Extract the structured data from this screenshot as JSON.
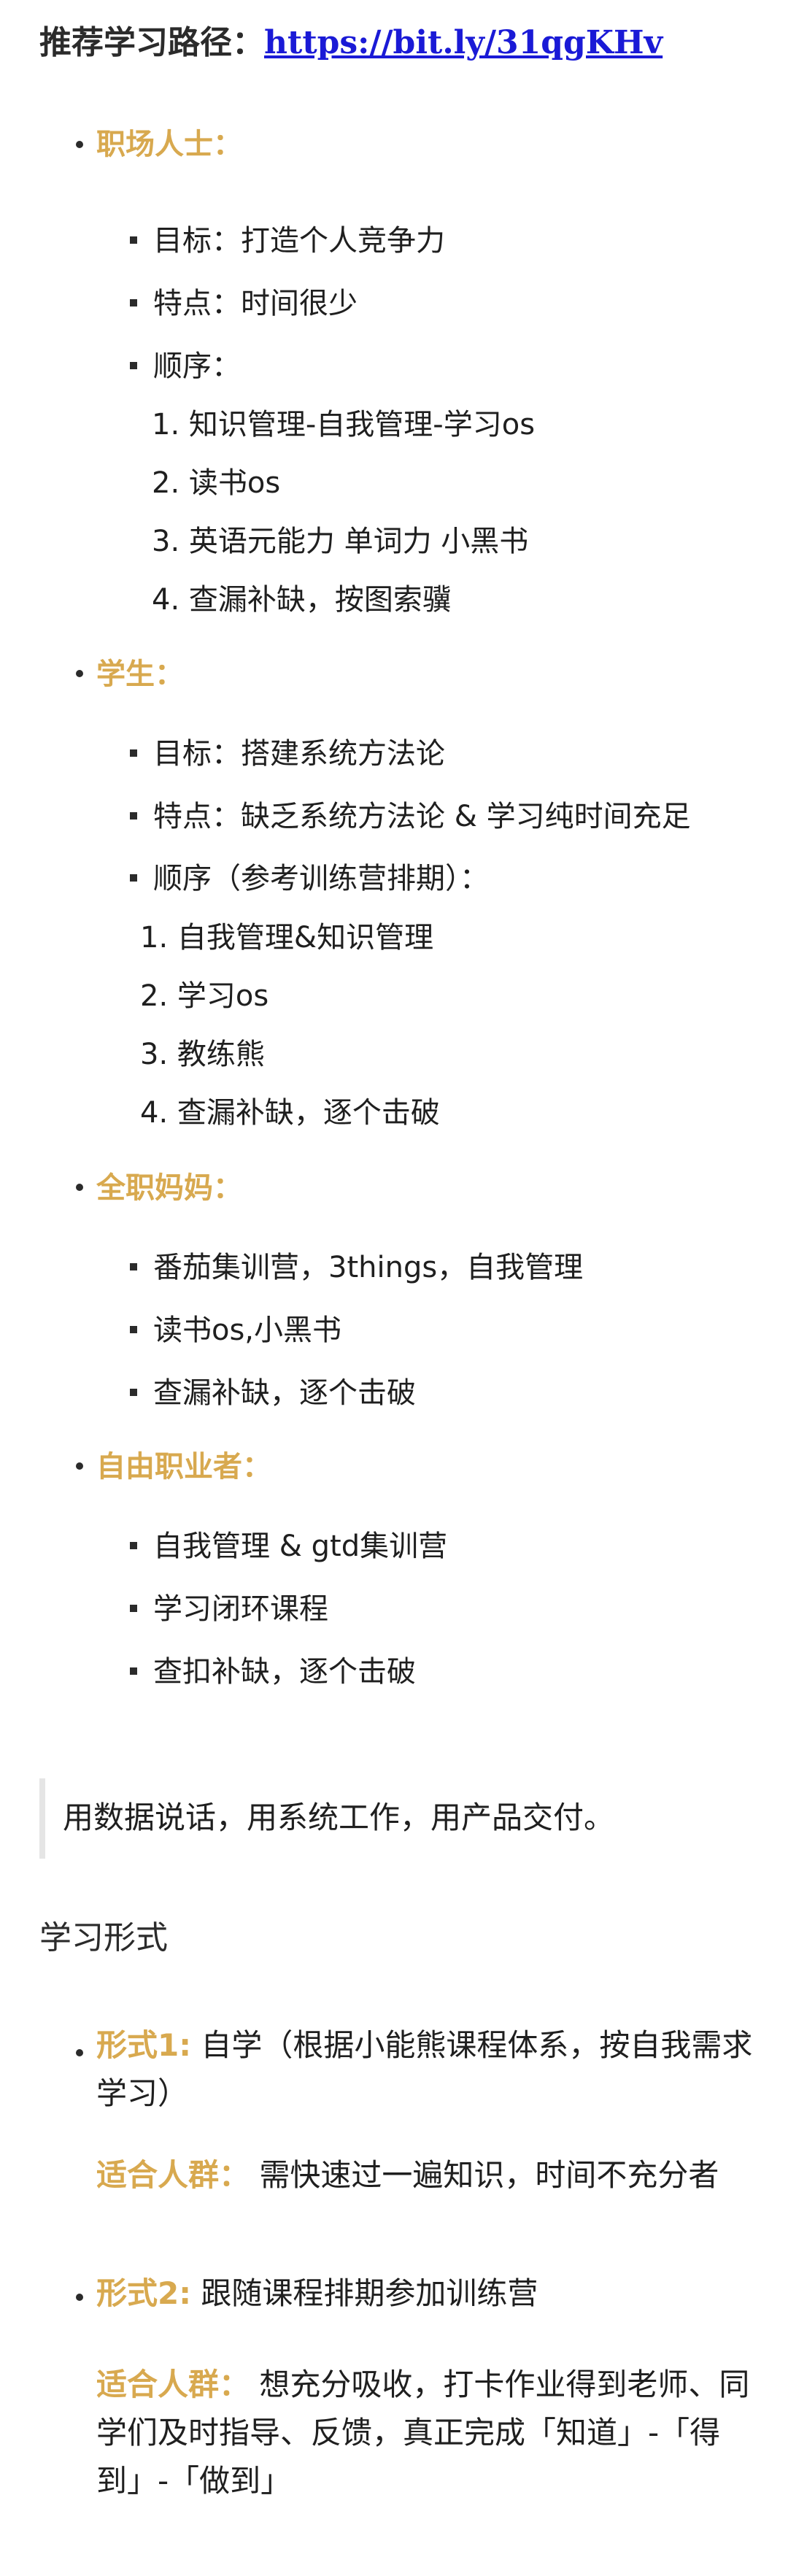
{
  "path": {
    "label": "推荐学习路径：",
    "url": "https://bit.ly/31qgKHv"
  },
  "groups": {
    "professional": {
      "title": "职场人士：",
      "items": [
        "目标：打造个人竞争力",
        "特点：时间很少",
        "顺序："
      ],
      "steps": [
        "1. 知识管理-自我管理-学习os",
        "2. 读书os",
        "3. 英语元能力 单词力 小黑书",
        "4. 查漏补缺，按图索骥"
      ]
    },
    "student": {
      "title": "学生：",
      "items": [
        "目标：搭建系统方法论",
        "特点：缺乏系统方法论 & 学习纯时间充足",
        "顺序（参考训练营排期）："
      ],
      "steps": [
        "1. 自我管理&知识管理",
        "2. 学习os",
        "3. 教练熊",
        "4. 查漏补缺，逐个击破"
      ]
    },
    "mom": {
      "title": "全职妈妈：",
      "items": [
        "番茄集训营，3things，自我管理",
        "读书os,小黑书",
        "查漏补缺，逐个击破"
      ]
    },
    "freelancer": {
      "title": "自由职业者：",
      "items": [
        "自我管理 & gtd集训营",
        "学习闭环课程",
        "查扣补缺，逐个击破"
      ]
    }
  },
  "quote": "用数据说话，用系统工作，用产品交付。",
  "forms": {
    "title": "学习形式",
    "f1_label": "形式1:",
    "f1_text": "自学（根据小能熊课程体系，按自我需求学习）",
    "f1_fit_label": "适合人群：",
    "f1_fit_text": "需快速过一遍知识，时间不充分者",
    "f2_label": "形式2:",
    "f2_text": "跟随课程排期参加训练营",
    "f2_fit_label": "适合人群：",
    "f2_fit_text": "想充分吸收，打卡作业得到老师、同学们及时指导、反馈，真正完成「知道」-「得到」-「做到」"
  }
}
